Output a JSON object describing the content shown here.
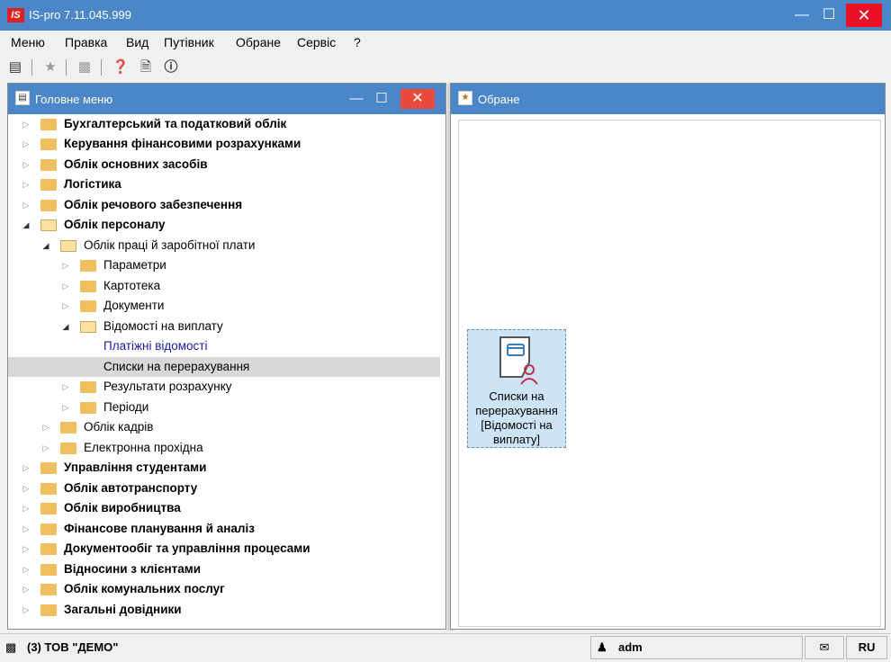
{
  "window": {
    "title": "IS-pro 7.11.045.999",
    "logo": "IS"
  },
  "menu": [
    "Меню",
    "Правка",
    "Вид",
    "Путівник",
    "Обране",
    "Сервіс",
    "?"
  ],
  "toolbar_icons": [
    "document-list-icon",
    "star-icon",
    "factory-icon",
    "help-icon",
    "document-info-icon",
    "info-icon"
  ],
  "left_panel": {
    "title": "Головне меню"
  },
  "tree": [
    {
      "label": "Бухгалтерський та податковий облік"
    },
    {
      "label": "Керування фінансовими розрахунками"
    },
    {
      "label": "Облік основних засобів"
    },
    {
      "label": "Логістика"
    },
    {
      "label": "Облік речового забезпечення"
    },
    {
      "label": "Облік персоналу"
    },
    {
      "label": "Облік праці й заробітної плати"
    },
    {
      "label": "Параметри"
    },
    {
      "label": "Картотека"
    },
    {
      "label": "Документи"
    },
    {
      "label": "Відомості на виплату"
    },
    {
      "label": "Платіжні відомості"
    },
    {
      "label": "Списки на перерахування"
    },
    {
      "label": "Результати розрахунку"
    },
    {
      "label": "Періоди"
    },
    {
      "label": "Облік кадрів"
    },
    {
      "label": "Електронна прохідна"
    },
    {
      "label": "Управління студентами"
    },
    {
      "label": "Облік автотранспорту"
    },
    {
      "label": "Облік виробництва"
    },
    {
      "label": "Фінансове планування й аналіз"
    },
    {
      "label": "Документообіг та управління процесами"
    },
    {
      "label": "Відносини з клієнтами"
    },
    {
      "label": "Облік комунальних послуг"
    },
    {
      "label": "Загальні довідники"
    }
  ],
  "right_panel": {
    "title": "Обране"
  },
  "favorite_tile": {
    "label": "Списки на перерахування [Відомості на виплату]"
  },
  "status": {
    "company": "(3) ТОВ \"ДЕМО\"",
    "user": "adm",
    "lang": "RU"
  },
  "colors": {
    "title_bar": "#4a86c8",
    "close": "#e81123",
    "folder": "#f0c060"
  }
}
